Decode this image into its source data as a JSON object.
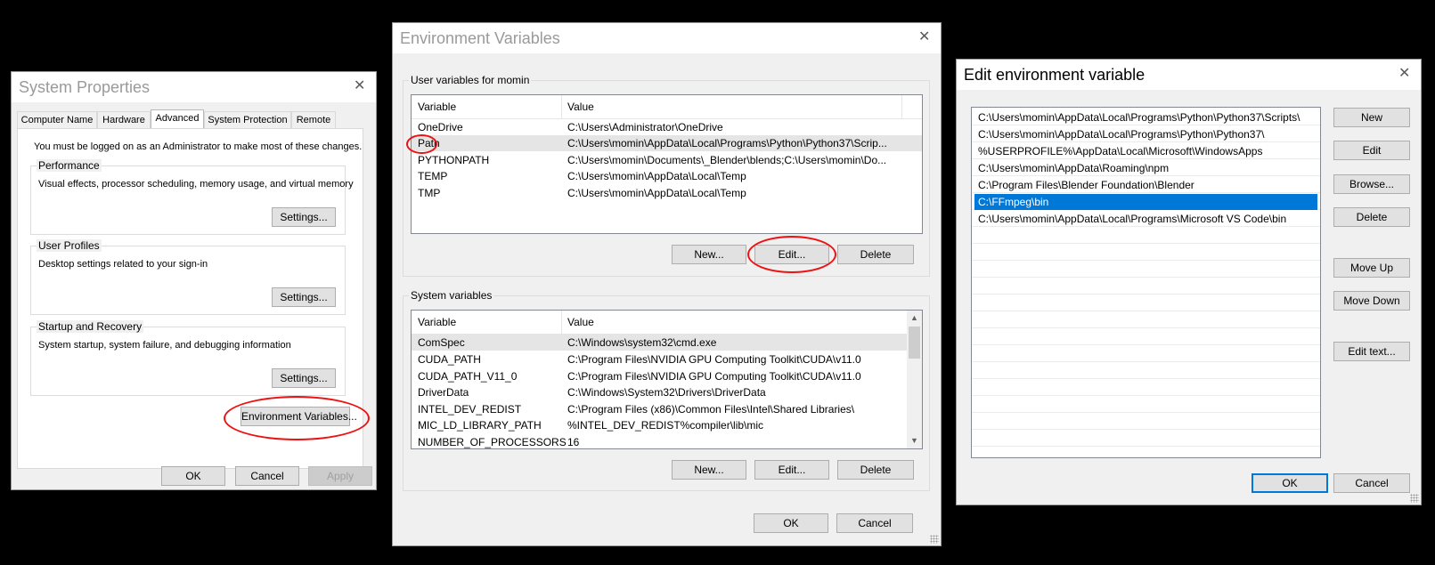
{
  "sysprops": {
    "title": "System Properties",
    "tabs": [
      "Computer Name",
      "Hardware",
      "Advanced",
      "System Protection",
      "Remote"
    ],
    "admin_note": "You must be logged on as an Administrator to make most of these changes.",
    "performance": {
      "label": "Performance",
      "desc": "Visual effects, processor scheduling, memory usage, and virtual memory",
      "button": "Settings..."
    },
    "profiles": {
      "label": "User Profiles",
      "desc": "Desktop settings related to your sign-in",
      "button": "Settings..."
    },
    "startup": {
      "label": "Startup and Recovery",
      "desc": "System startup, system failure, and debugging information",
      "button": "Settings..."
    },
    "env_button": "Environment Variables...",
    "ok": "OK",
    "cancel": "Cancel",
    "apply": "Apply"
  },
  "envvars": {
    "title": "Environment Variables",
    "user_group": "User variables for momin",
    "system_group": "System variables",
    "col_variable": "Variable",
    "col_value": "Value",
    "user_rows": [
      {
        "name": "OneDrive",
        "value": "C:\\Users\\Administrator\\OneDrive"
      },
      {
        "name": "Path",
        "value": "C:\\Users\\momin\\AppData\\Local\\Programs\\Python\\Python37\\Scrip..."
      },
      {
        "name": "PYTHONPATH",
        "value": "C:\\Users\\momin\\Documents\\_Blender\\blends;C:\\Users\\momin\\Do..."
      },
      {
        "name": "TEMP",
        "value": "C:\\Users\\momin\\AppData\\Local\\Temp"
      },
      {
        "name": "TMP",
        "value": "C:\\Users\\momin\\AppData\\Local\\Temp"
      }
    ],
    "system_rows": [
      {
        "name": "ComSpec",
        "value": "C:\\Windows\\system32\\cmd.exe"
      },
      {
        "name": "CUDA_PATH",
        "value": "C:\\Program Files\\NVIDIA GPU Computing Toolkit\\CUDA\\v11.0"
      },
      {
        "name": "CUDA_PATH_V11_0",
        "value": "C:\\Program Files\\NVIDIA GPU Computing Toolkit\\CUDA\\v11.0"
      },
      {
        "name": "DriverData",
        "value": "C:\\Windows\\System32\\Drivers\\DriverData"
      },
      {
        "name": "INTEL_DEV_REDIST",
        "value": "C:\\Program Files (x86)\\Common Files\\Intel\\Shared Libraries\\"
      },
      {
        "name": "MIC_LD_LIBRARY_PATH",
        "value": "%INTEL_DEV_REDIST%compiler\\lib\\mic"
      },
      {
        "name": "NUMBER_OF_PROCESSORS",
        "value": "16"
      }
    ],
    "new": "New...",
    "edit": "Edit...",
    "delete": "Delete",
    "ok": "OK",
    "cancel": "Cancel"
  },
  "editenv": {
    "title": "Edit environment variable",
    "paths": [
      "C:\\Users\\momin\\AppData\\Local\\Programs\\Python\\Python37\\Scripts\\",
      "C:\\Users\\momin\\AppData\\Local\\Programs\\Python\\Python37\\",
      "%USERPROFILE%\\AppData\\Local\\Microsoft\\WindowsApps",
      "C:\\Users\\momin\\AppData\\Roaming\\npm",
      "C:\\Program Files\\Blender Foundation\\Blender",
      "C:\\FFmpeg\\bin",
      "C:\\Users\\momin\\AppData\\Local\\Programs\\Microsoft VS Code\\bin"
    ],
    "new": "New",
    "edit": "Edit",
    "browse": "Browse...",
    "delete": "Delete",
    "move_up": "Move Up",
    "move_down": "Move Down",
    "edit_text": "Edit text...",
    "ok": "OK",
    "cancel": "Cancel"
  },
  "close_glyph": "✕",
  "colors": {
    "selection": "#0078d7",
    "annotation": "#e11111"
  }
}
